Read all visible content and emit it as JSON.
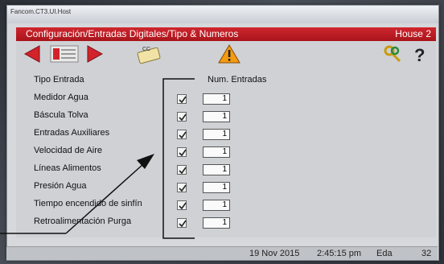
{
  "window": {
    "title": "Fancom.CT3.UI.Host"
  },
  "header": {
    "title": "Configuración/Entradas Digitales/Tipo & Numeros",
    "house": "House 2"
  },
  "toolbar": {
    "cc_label": "CC"
  },
  "table": {
    "col_type": "Tipo Entrada",
    "col_num": "Num. Entradas",
    "rows": [
      {
        "label": "Medidor Agua",
        "checked": true,
        "value": "1"
      },
      {
        "label": "Báscula Tolva",
        "checked": true,
        "value": "1"
      },
      {
        "label": "Entradas Auxiliares",
        "checked": true,
        "value": "1"
      },
      {
        "label": "Velocidad de Aire",
        "checked": true,
        "value": "1"
      },
      {
        "label": "Líneas Alimentos",
        "checked": true,
        "value": "1"
      },
      {
        "label": "Presión Agua",
        "checked": true,
        "value": "1"
      },
      {
        "label": "Tiempo encendido de sinfín",
        "checked": true,
        "value": "1"
      },
      {
        "label": "Retroalimentación Purga",
        "checked": true,
        "value": "1"
      }
    ]
  },
  "status": {
    "date": "19 Nov 2015",
    "time": "2:45:15 pm",
    "unit": "Eda",
    "number": "32"
  },
  "colors": {
    "header_red": "#c41e25",
    "arrow_red": "#d2232a",
    "warning_orange": "#f39c12"
  }
}
